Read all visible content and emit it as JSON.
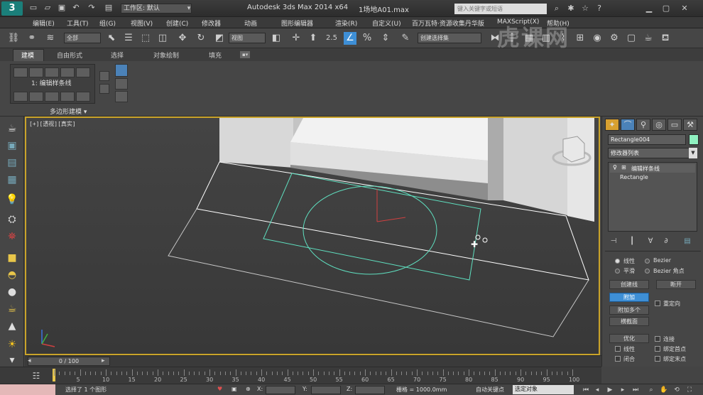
{
  "titlebar": {
    "logo": "3",
    "workspace": "工作区: 默认",
    "app_title": "Autodesk 3ds Max  2014 x64",
    "file_title": "1场地A01.max",
    "search_placeholder": "键入关键字或短语"
  },
  "menu": [
    "编辑(E)",
    "工具(T)",
    "组(G)",
    "视图(V)",
    "创建(C)",
    "修改器",
    "动画",
    "图形编辑器",
    "渲染(R)",
    "自定义(U)",
    "百万瓦特·资源收集丹华版",
    "MAXScript(X)",
    "帮助(H)"
  ],
  "toolbar": {
    "selection_filter": "全部",
    "ref_coord": "视图",
    "named_selection": "创建选择集",
    "snap_label": "2.5"
  },
  "ribbon": {
    "tabs": [
      "建模",
      "自由形式",
      "选择",
      "对象绘制",
      "填充"
    ],
    "active_tab": "建模",
    "edit_label": "1: 编辑样条线",
    "group_label": "多边形建模"
  },
  "viewport": {
    "label": "[+][透视][真实]"
  },
  "command_panel": {
    "object_name": "Rectangle004",
    "object_color": "#8ff0c0",
    "modifier_list": "修改器列表",
    "stack": [
      {
        "label": "编辑样条线"
      },
      {
        "label": "Rectangle"
      }
    ],
    "radio_linear": "线性",
    "radio_bezier": "Bezier",
    "radio_smooth": "平滑",
    "radio_bezier_corner": "Bezier 角点",
    "btn_create_line": "创建线",
    "btn_break": "断开",
    "btn_attach": "附加",
    "btn_attach_multi": "附加多个",
    "chk_reorient": "重定向",
    "btn_cross_section": "横截面",
    "btn_refine": "优化",
    "chk_connect": "连接",
    "chk_linear": "线性",
    "chk_bind_first": "绑定首点",
    "chk_closed": "闭合",
    "chk_bind_last": "绑定末点",
    "connect_copy": "连接复制"
  },
  "timeline": {
    "frame_display": "0 / 100",
    "ticks": [
      "5",
      "10",
      "15",
      "20",
      "25",
      "30",
      "35",
      "40",
      "45",
      "50",
      "55",
      "60",
      "65",
      "70",
      "75",
      "80",
      "85",
      "90",
      "95",
      "100"
    ]
  },
  "status": {
    "selection_text": "选择了 1 个图形",
    "x_label": "X:",
    "y_label": "Y:",
    "z_label": "Z:",
    "grid_text": "栅格 = 1000.0mm",
    "autokey_label": "自动关键点",
    "key_mode": "选定对象"
  },
  "watermark": "虎课网"
}
